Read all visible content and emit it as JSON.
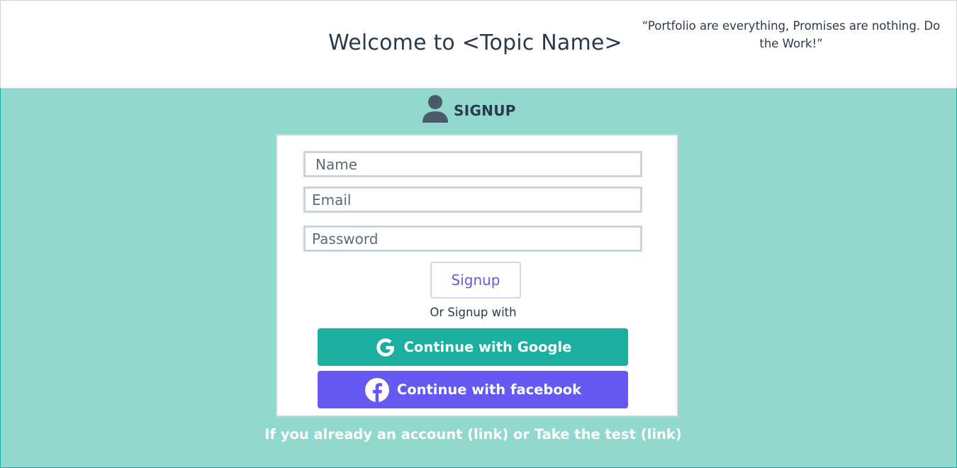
{
  "header": {
    "welcome_title": "Welcome to <Topic Name>",
    "quote": "“Portfolio are everything, Promises are nothing. Do the Work!”"
  },
  "signup": {
    "heading": "SIGNUP",
    "heading_icon": "user-icon"
  },
  "form": {
    "name_placeholder": "Name",
    "email_placeholder": "Email",
    "password_placeholder": "Password",
    "submit_label": "Signup"
  },
  "social": {
    "divider_text": "Or Signup with",
    "google_label": "Continue with Google",
    "google_icon": "google-icon",
    "facebook_label": "Continue with facebook",
    "facebook_icon": "facebook-icon"
  },
  "footer": {
    "text": "If you already an account (link) or Take the test (link)"
  },
  "colors": {
    "background": "#91d8cf",
    "google_button": "#1baf9f",
    "facebook_button": "#6658f2",
    "signup_text": "#6758e8",
    "dark_text": "#2b3a4a"
  }
}
